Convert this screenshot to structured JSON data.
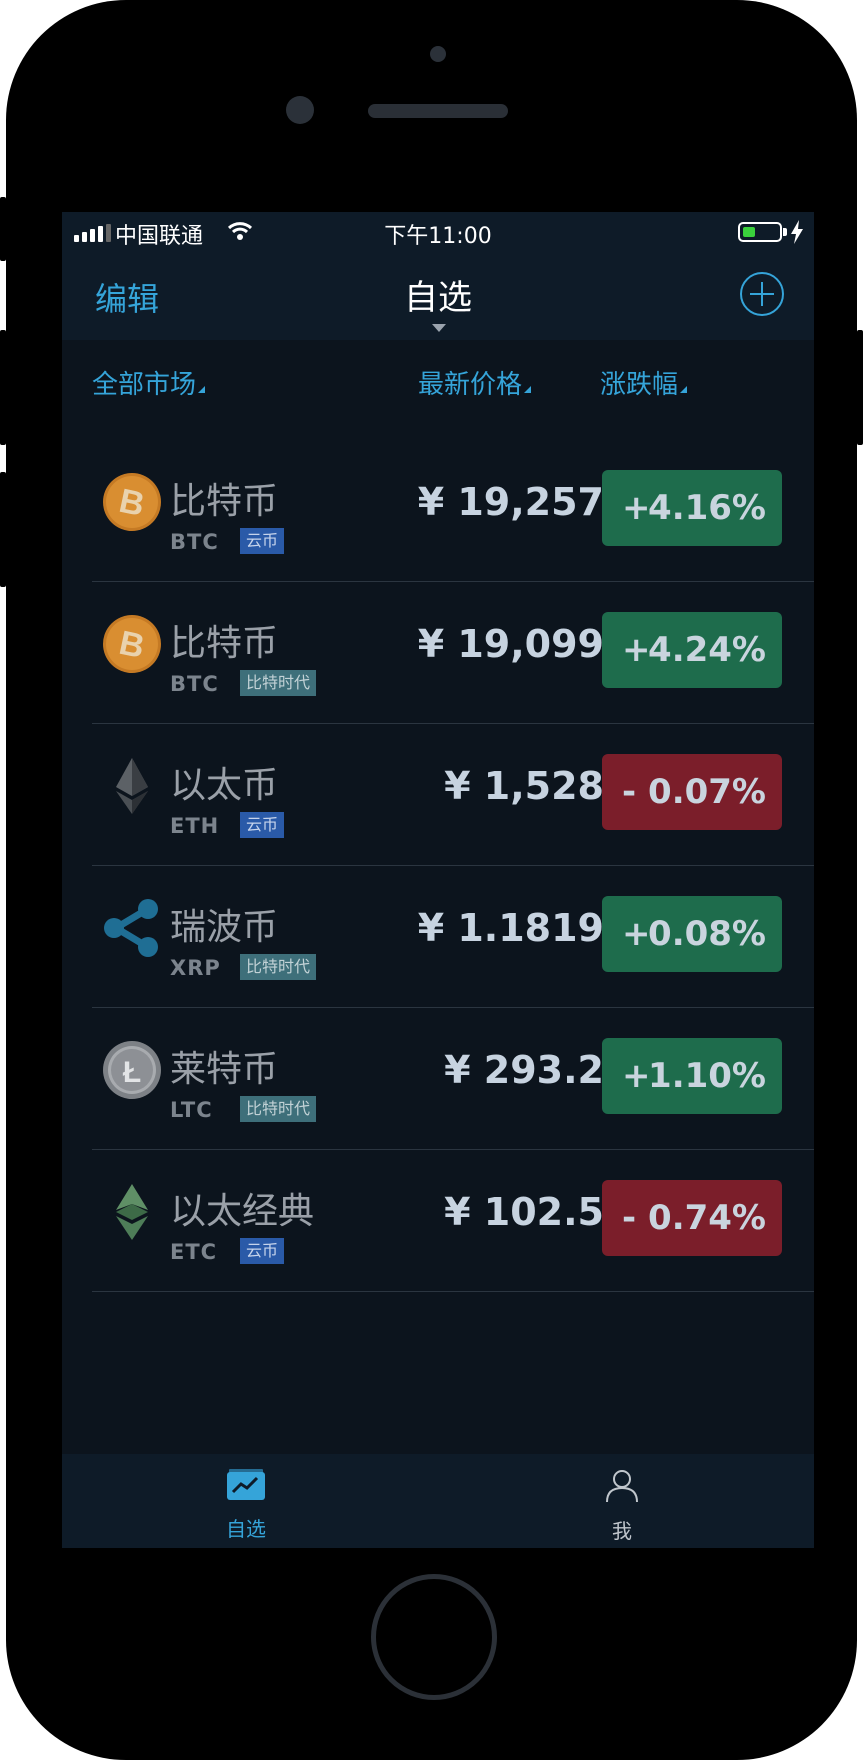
{
  "status_bar": {
    "carrier": "中国联通",
    "time": "下午11:00"
  },
  "nav": {
    "edit_label": "编辑",
    "title": "自选",
    "add_icon": "plus-circle-icon"
  },
  "columns": {
    "market": "全部市场",
    "price": "最新价格",
    "change": "涨跌幅"
  },
  "coins": [
    {
      "name": "比特币",
      "symbol": "BTC",
      "tag": "云币",
      "tag_type": "cloud",
      "price": "¥ 19,257",
      "sign": "+",
      "change": "4.16%",
      "direction": "up",
      "icon": "bitcoin-icon"
    },
    {
      "name": "比特币",
      "symbol": "BTC",
      "tag": "比特时代",
      "tag_type": "era",
      "price": "¥ 19,099",
      "sign": "+",
      "change": "4.24%",
      "direction": "up",
      "icon": "bitcoin-icon"
    },
    {
      "name": "以太币",
      "symbol": "ETH",
      "tag": "云币",
      "tag_type": "cloud",
      "price": "¥ 1,528",
      "sign": "-",
      "change": "0.07%",
      "direction": "down",
      "icon": "ethereum-icon"
    },
    {
      "name": "瑞波币",
      "symbol": "XRP",
      "tag": "比特时代",
      "tag_type": "era",
      "price": "¥ 1.1819",
      "sign": "+",
      "change": "0.08%",
      "direction": "up",
      "icon": "ripple-icon"
    },
    {
      "name": "莱特币",
      "symbol": "LTC",
      "tag": "比特时代",
      "tag_type": "era",
      "price": "¥ 293.2",
      "sign": "+",
      "change": "1.10%",
      "direction": "up",
      "icon": "litecoin-icon"
    },
    {
      "name": "以太经典",
      "symbol": "ETC",
      "tag": "云币",
      "tag_type": "cloud",
      "price": "¥ 102.5",
      "sign": "-",
      "change": "0.74%",
      "direction": "down",
      "icon": "ethereum-classic-icon"
    }
  ],
  "tabbar": {
    "watchlist_label": "自选",
    "me_label": "我"
  },
  "colors": {
    "accent": "#35a4d9",
    "up": "#1e6c4c",
    "down": "#7b1e2a",
    "background": "#0c141d"
  }
}
